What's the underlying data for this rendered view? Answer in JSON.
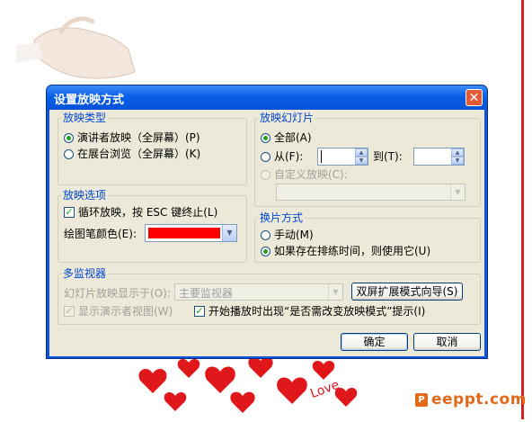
{
  "dialog": {
    "title": "设置放映方式",
    "close_label": "✕"
  },
  "show_type": {
    "label": "放映类型",
    "options": [
      {
        "label": "演讲者放映（全屏幕）(P)",
        "selected": true
      },
      {
        "label": "在展台浏览（全屏幕）(K)",
        "selected": false
      }
    ]
  },
  "show_options": {
    "label": "放映选项",
    "loop_label": "循环放映，按 ESC 键终止(L)",
    "loop_checked": true,
    "pen_color_label": "绘图笔颜色(E):",
    "pen_color": "#ff0000"
  },
  "slides": {
    "label": "放映幻灯片",
    "all_label": "全部(A)",
    "from_label": "从(F):",
    "to_label": "到(T):",
    "from_value": "",
    "to_value": "",
    "custom_label": "自定义放映(C):",
    "custom_value": ""
  },
  "advance": {
    "label": "换片方式",
    "manual_label": "手动(M)",
    "timings_label": "如果存在排练时间，则使用它(U)"
  },
  "monitors": {
    "label": "多监视器",
    "display_on_label": "幻灯片放映显示于(O):",
    "display_on_value": "主要监视器",
    "wizard_label": "双屏扩展模式向导(S)",
    "presenter_view_label": "显示演示者视图(W)",
    "prompt_label": "开始播放时出现“是否需改变放映模式”提示(I)",
    "prompt_checked": true
  },
  "buttons": {
    "ok": "确定",
    "cancel": "取消"
  },
  "watermark": {
    "brand": "eeppt.com",
    "logo_letter": "P",
    "hearts_text": "Love"
  },
  "colors": {
    "title_bar": "#0a5fe8",
    "dialog_face": "#ece9d8",
    "group_label": "#0046d5",
    "accent_red": "#d42020"
  }
}
